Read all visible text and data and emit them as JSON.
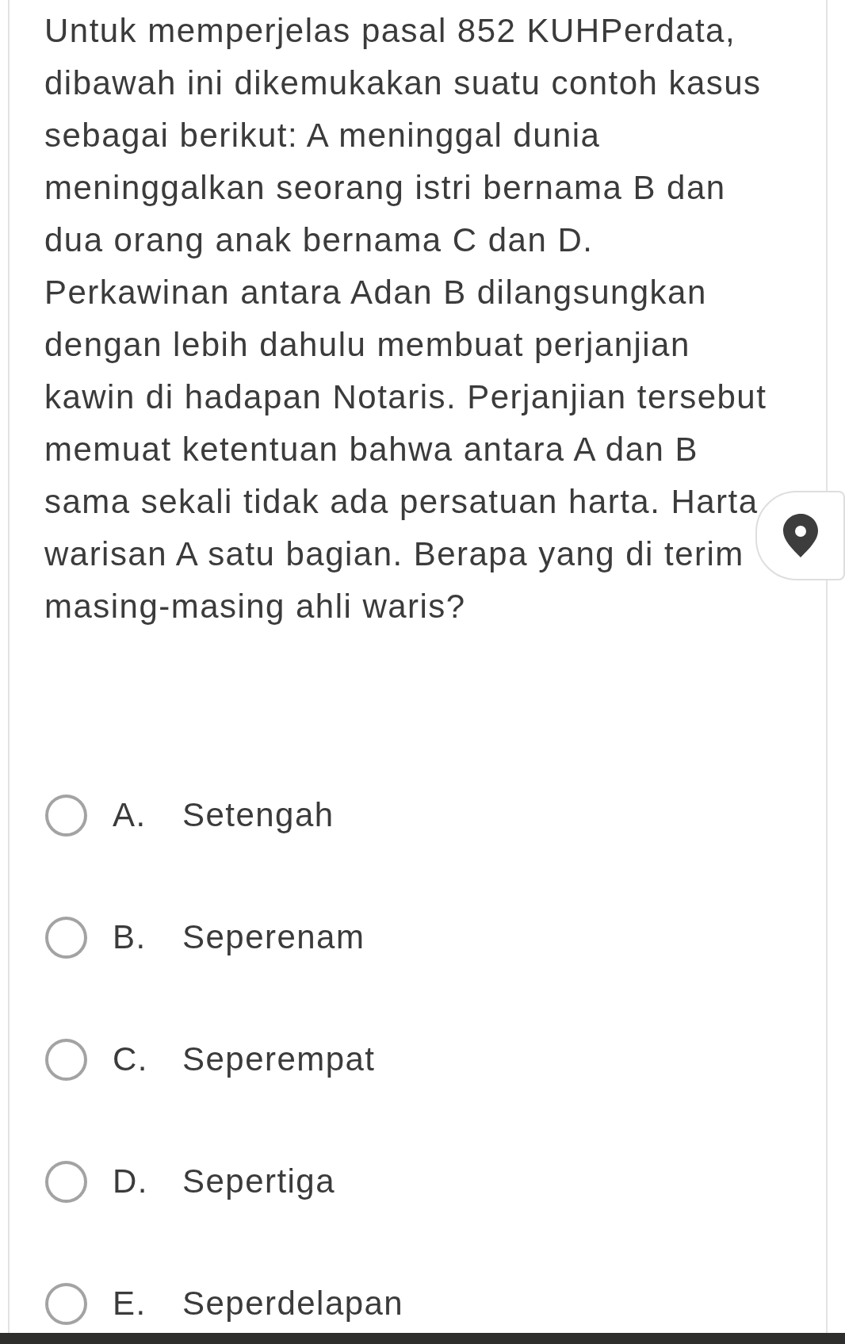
{
  "question": {
    "lines": [
      "Untuk memperjelas pasal 852 KUHPerdata,",
      "dibawah ini dikemukakan suatu contoh kasus",
      "sebagai berikut: A meninggal dunia",
      "meninggalkan seorang istri bernama B dan",
      "dua orang anak bernama C dan D.",
      "Perkawinan antara Adan B dilangsungkan",
      "dengan lebih dahulu membuat perjanjian",
      "kawin di hadapan Notaris. Perjanjian tersebut",
      "memuat ketentuan bahwa antara A dan B",
      "sama sekali tidak ada persatuan harta. Harta",
      "warisan A satu bagian. Berapa yang di terim",
      "masing-masing ahli waris?"
    ]
  },
  "options": [
    {
      "letter": "A.",
      "text": "Setengah",
      "selected": false
    },
    {
      "letter": "B.",
      "text": "Seperenam",
      "selected": false
    },
    {
      "letter": "C.",
      "text": "Seperempat",
      "selected": false
    },
    {
      "letter": "D.",
      "text": "Sepertiga",
      "selected": false
    },
    {
      "letter": "E.",
      "text": "Seperdelapan",
      "selected": false
    }
  ]
}
